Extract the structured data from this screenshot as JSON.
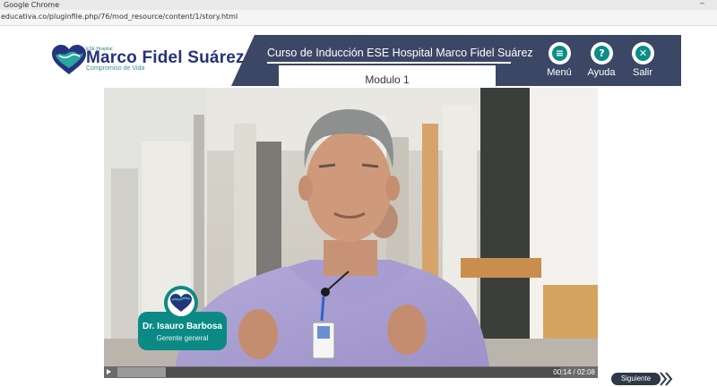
{
  "browser": {
    "app_title": "Google Chrome",
    "minimize_glyph": "–",
    "url": "educativa.co/pluginfile.php/76/mod_resource/content/1/story.html"
  },
  "logo": {
    "small_text": "ESE Hospital",
    "name": "Marco Fidel Suárez",
    "tagline": "Compromiso de Vida"
  },
  "course": {
    "title": "Curso de Inducción  ESE Hospital Marco Fidel Suárez",
    "module": "Modulo 1"
  },
  "nav": {
    "menu": {
      "label": "Menú",
      "icon": "menu-icon",
      "glyph": "≡"
    },
    "help": {
      "label": "Ayuda",
      "icon": "help-icon",
      "glyph": "?"
    },
    "exit": {
      "label": "Salir",
      "icon": "close-icon",
      "glyph": "✕"
    }
  },
  "speaker": {
    "name": "Dr. Isauro Barbosa",
    "role": "Gerente general"
  },
  "player": {
    "time": "00:14 / 02:08",
    "progress": 0.11
  },
  "next_button": {
    "label": "Siguiente"
  },
  "colors": {
    "header_dark": "#3c4766",
    "brand_blue": "#26337a",
    "brand_teal": "#0a8d86"
  }
}
